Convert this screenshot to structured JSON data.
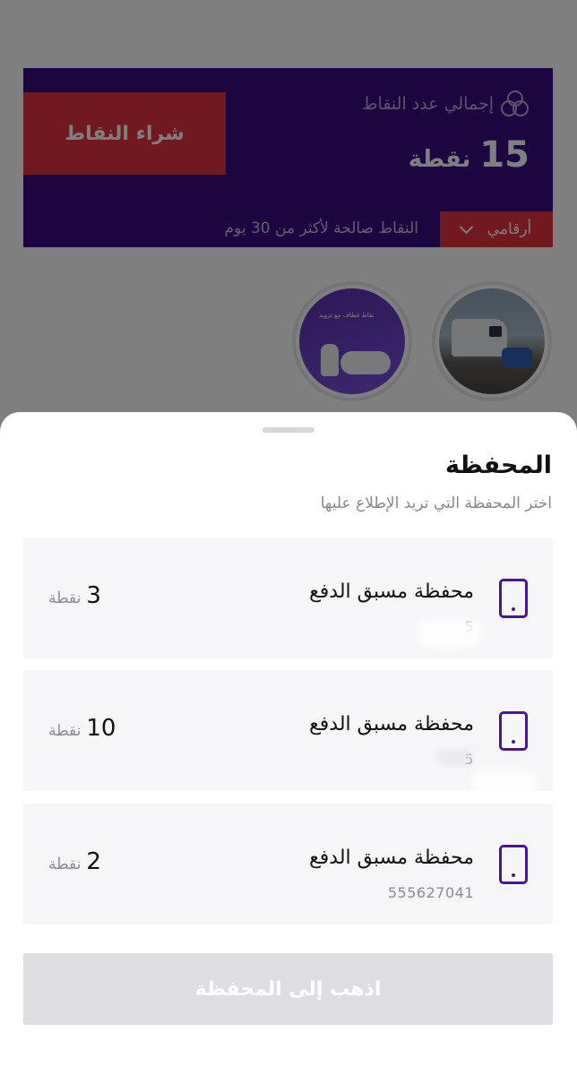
{
  "points_card": {
    "title": "إجمالي عدد النقاط",
    "total_value": "15",
    "total_unit": "نقطة",
    "buy_button": "شراء النقاط",
    "dropdown_label": "أرقامي",
    "validity_note": "النقاط صالحة لأكثر من 30 يوم",
    "story_text": "نقاط قطاف مع تزويد"
  },
  "sheet": {
    "title": "المحفظة",
    "subtitle": "اختر المحفظة التي تريد الإطلاع عليها",
    "wallets": [
      {
        "name": "محفظة مسبق الدفع",
        "number": "5",
        "points": "3",
        "unit": "نقطة"
      },
      {
        "name": "محفظة مسبق الدفع",
        "number": "5",
        "points": "10",
        "unit": "نقطة"
      },
      {
        "name": "محفظة مسبق الدفع",
        "number": "555627041",
        "points": "2",
        "unit": "نقطة"
      }
    ],
    "go_button": "اذهب إلى المحفظة"
  },
  "colors": {
    "brand_purple": "#3a0d7e",
    "accent_red": "#e2323f",
    "icon_purple": "#4a1590",
    "disabled_button": "#dedee2"
  }
}
